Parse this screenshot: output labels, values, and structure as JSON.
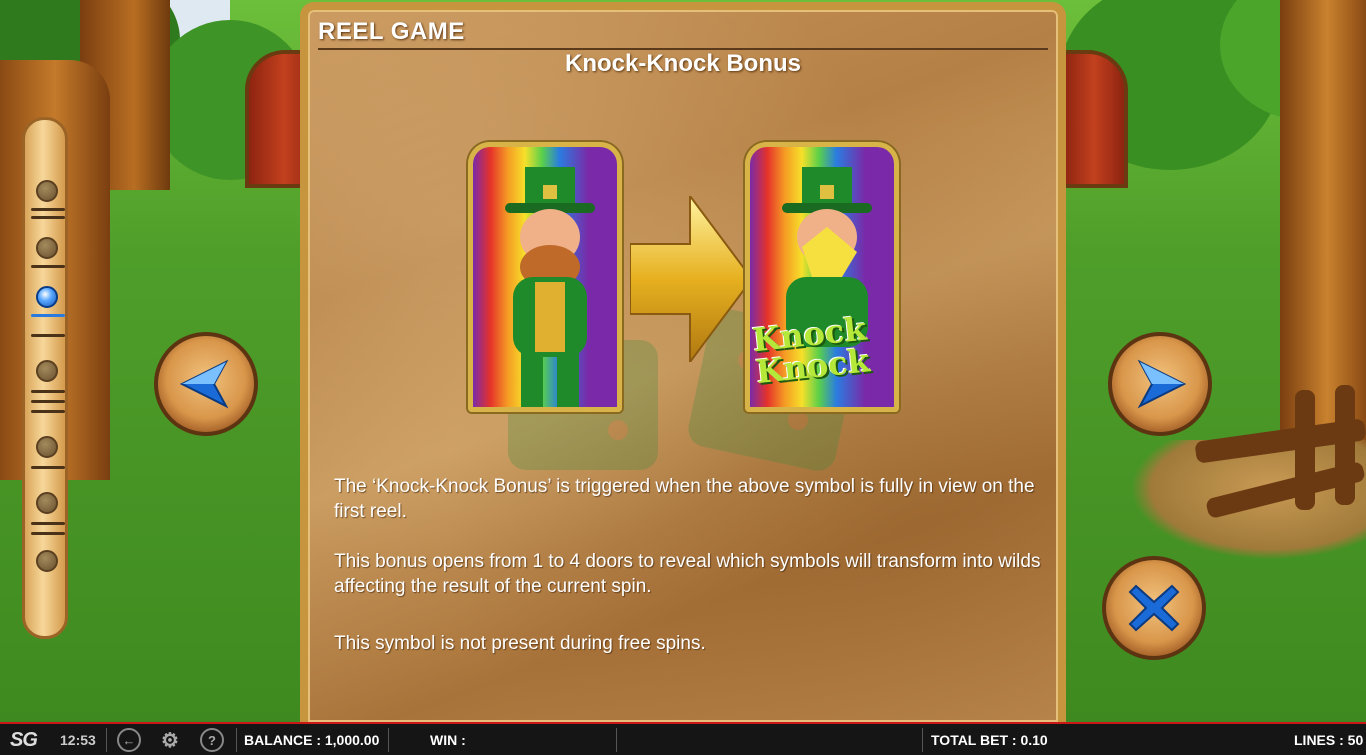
{
  "panel": {
    "header": "REEL GAME",
    "title": "Knock-Knock Bonus",
    "paragraphs": [
      "The ‘Knock-Knock Bonus’ is triggered when the above symbol is fully in view on the first reel.",
      "This bonus opens from 1 to 4 doors to reveal which symbols will transform into wilds affecting the result of the current spin.",
      "This symbol is not present during free spins."
    ],
    "symbol_overlay_text": "Knock Knock"
  },
  "navigation": {
    "page_count": 7,
    "active_page": 3,
    "prev_icon": "arrow-left-icon",
    "next_icon": "arrow-right-icon",
    "close_icon": "close-x-icon"
  },
  "status_bar": {
    "logo": "SG",
    "time": "12:53",
    "balance_label": "BALANCE : 1,000.00",
    "win_label": "WIN :",
    "total_bet_label": "TOTAL BET : 0.10",
    "lines_label": "LINES : 50",
    "icons": [
      "back-icon",
      "settings-gear-icon",
      "help-icon"
    ]
  },
  "colors": {
    "accent_red": "#c81818",
    "nav_blue": "#1a6ad8",
    "panel_wood": "#b58045",
    "panel_border": "#c8953f"
  }
}
